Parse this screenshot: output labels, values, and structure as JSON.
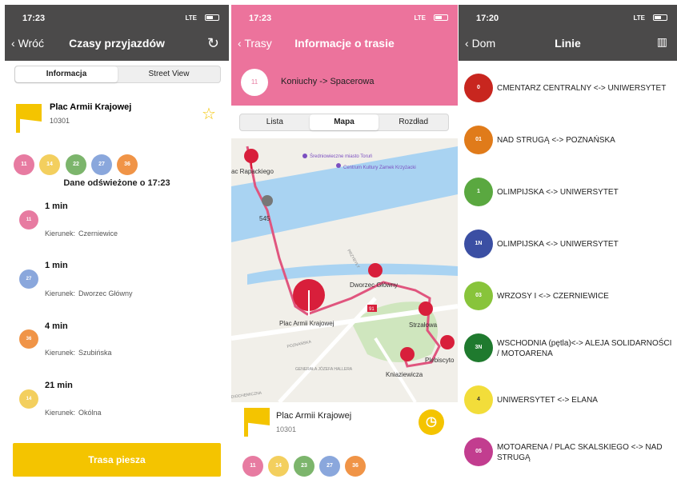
{
  "panel1": {
    "status": {
      "time": "17:23",
      "network": "LTE"
    },
    "nav": {
      "back": "Wróć",
      "title": "Czasy przyjazdów"
    },
    "tabs": [
      "Informacja",
      "Street View"
    ],
    "stop": {
      "name": "Plac Armii Krajowej",
      "code": "10301"
    },
    "lines": [
      {
        "label": "11",
        "color": "#e77ba1"
      },
      {
        "label": "14",
        "color": "#f3cf5e"
      },
      {
        "label": "22",
        "color": "#7cb56c"
      },
      {
        "label": "27",
        "color": "#8aa7dc"
      },
      {
        "label": "36",
        "color": "#f09447"
      }
    ],
    "refreshed": "Dane odświeżone o 17:23",
    "direction_label": "Kierunek:",
    "departures": [
      {
        "min": "1 min",
        "line": "11",
        "color": "#e77ba1",
        "direction": "Czerniewice"
      },
      {
        "min": "1 min",
        "line": "27",
        "color": "#8aa7dc",
        "direction": "Dworzec Główny"
      },
      {
        "min": "4 min",
        "line": "36",
        "color": "#f09447",
        "direction": "Szubińska"
      },
      {
        "min": "21 min",
        "line": "14",
        "color": "#f3cf5e",
        "direction": "Okólna"
      }
    ],
    "bottom_button": "Trasa piesza",
    "accent": "#f4c400"
  },
  "panel2": {
    "status": {
      "time": "17:23",
      "network": "LTE"
    },
    "nav": {
      "back": "Trasy",
      "title": "Informacje o trasie"
    },
    "route": {
      "line": "11",
      "text": "Koniuchy -> Spacerowa"
    },
    "tabs": [
      "Lista",
      "Mapa",
      "Rozdład"
    ],
    "map": {
      "labels": {
        "rapackiego": "ac Rapackiego",
        "museum": "Średniowieczne miasto Toruń",
        "centrum": "Centrum Kultury Zamek Krzyżacki",
        "bus": "545",
        "dworzec": "Dworzec Główny",
        "plac": "Plac Armii Krajowej",
        "strzalowa": "Strzałowa",
        "plebiscytowa": "Plebiscyto",
        "kniaziewicza": "Kniaziewicza",
        "road_sign": "91",
        "street1": "POZNAŃSKA",
        "street2": "GENERAŁA JÓZEFA HALLERA",
        "street3": "PRZYBYŁY",
        "street4": "DIOCHEMICZNA"
      }
    },
    "stop": {
      "name": "Plac Armii Krajowej",
      "code": "10301"
    },
    "lines": [
      {
        "label": "11",
        "color": "#e77ba1"
      },
      {
        "label": "14",
        "color": "#f3cf5e"
      },
      {
        "label": "23",
        "color": "#7cb56c"
      },
      {
        "label": "27",
        "color": "#8aa7dc"
      },
      {
        "label": "36",
        "color": "#f09447"
      }
    ]
  },
  "panel3": {
    "status": {
      "time": "17:20",
      "network": "LTE"
    },
    "nav": {
      "back": "Dom",
      "title": "Linie"
    },
    "lines": [
      {
        "badge": "0",
        "color": "#c8261f",
        "name": "CMENTARZ CENTRALNY <-> UNIWERSYTET"
      },
      {
        "badge": "01",
        "color": "#e07b1a",
        "name": "NAD STRUGĄ <-> POZNAŃSKA"
      },
      {
        "badge": "1",
        "color": "#5aa840",
        "name": "OLIMPIJSKA <-> UNIWERSYTET"
      },
      {
        "badge": "1N",
        "color": "#3b4fa3",
        "name": "OLIMPIJSKA <-> UNIWERSYTET"
      },
      {
        "badge": "03",
        "color": "#88c43b",
        "name": "WRZOSY I <-> CZERNIEWICE"
      },
      {
        "badge": "3N",
        "color": "#1f7a2e",
        "name": "WSCHODNIA (pętla)<-> ALEJA SOLIDARNOŚCI / MOTOARENA"
      },
      {
        "badge": "4",
        "color": "#f2dd3a",
        "name": "UNIWERSYTET <-> ELANA"
      },
      {
        "badge": "05",
        "color": "#c23d8f",
        "name": "MOTOARENA / PLAC SKALSKIEGO <-> NAD STRUGĄ"
      }
    ]
  }
}
